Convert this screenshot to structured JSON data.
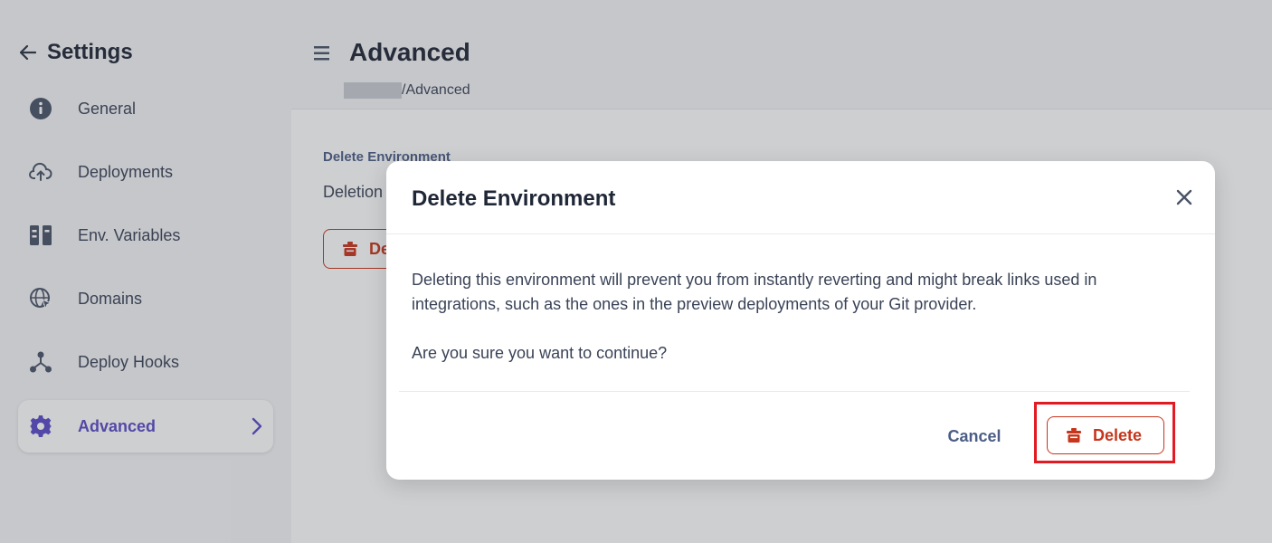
{
  "sidebar": {
    "title": "Settings",
    "items": [
      {
        "label": "General",
        "icon": "info-icon"
      },
      {
        "label": "Deployments",
        "icon": "cloud-upload-icon"
      },
      {
        "label": "Env. Variables",
        "icon": "env-panels-icon"
      },
      {
        "label": "Domains",
        "icon": "globe-cursor-icon"
      },
      {
        "label": "Deploy Hooks",
        "icon": "webhook-icon"
      },
      {
        "label": "Advanced",
        "icon": "gear-icon",
        "active": true
      }
    ]
  },
  "main": {
    "title": "Advanced",
    "breadcrumb_tail": "/Advanced",
    "section_title": "Delete Environment",
    "section_desc": "Deletion",
    "bg_delete_label": "De"
  },
  "modal": {
    "title": "Delete Environment",
    "body": "Deleting this environment will prevent you from instantly reverting and might break links used in integrations, such as the ones in the preview deployments of your Git provider.",
    "question": "Are you sure you want to continue?",
    "cancel_label": "Cancel",
    "delete_label": "Delete"
  },
  "colors": {
    "accent": "#5b4bc7",
    "danger": "#c7351c",
    "highlight": "#e21b23"
  }
}
